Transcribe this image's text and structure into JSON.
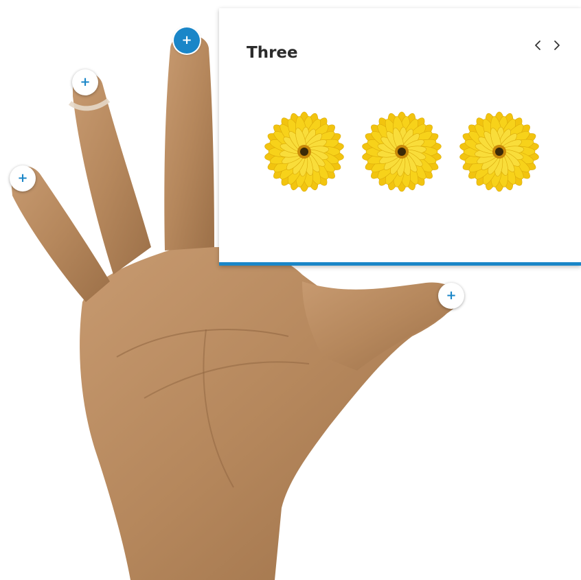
{
  "popup": {
    "title": "Three",
    "prev_icon": "chevron-left-icon",
    "next_icon": "chevron-right-icon",
    "flower_count": 3,
    "flower_icon": "sunflower-icon"
  },
  "hotspots": [
    {
      "name": "pinky",
      "symbol": "+",
      "active": false
    },
    {
      "name": "ring",
      "symbol": "+",
      "active": false
    },
    {
      "name": "middle",
      "symbol": "+",
      "active": true
    },
    {
      "name": "thumb",
      "symbol": "+",
      "active": false
    }
  ],
  "colors": {
    "accent": "#1a86c8",
    "skin": "#b8865a",
    "petal": "#f7d21a",
    "flower_center": "#3a2a08"
  }
}
